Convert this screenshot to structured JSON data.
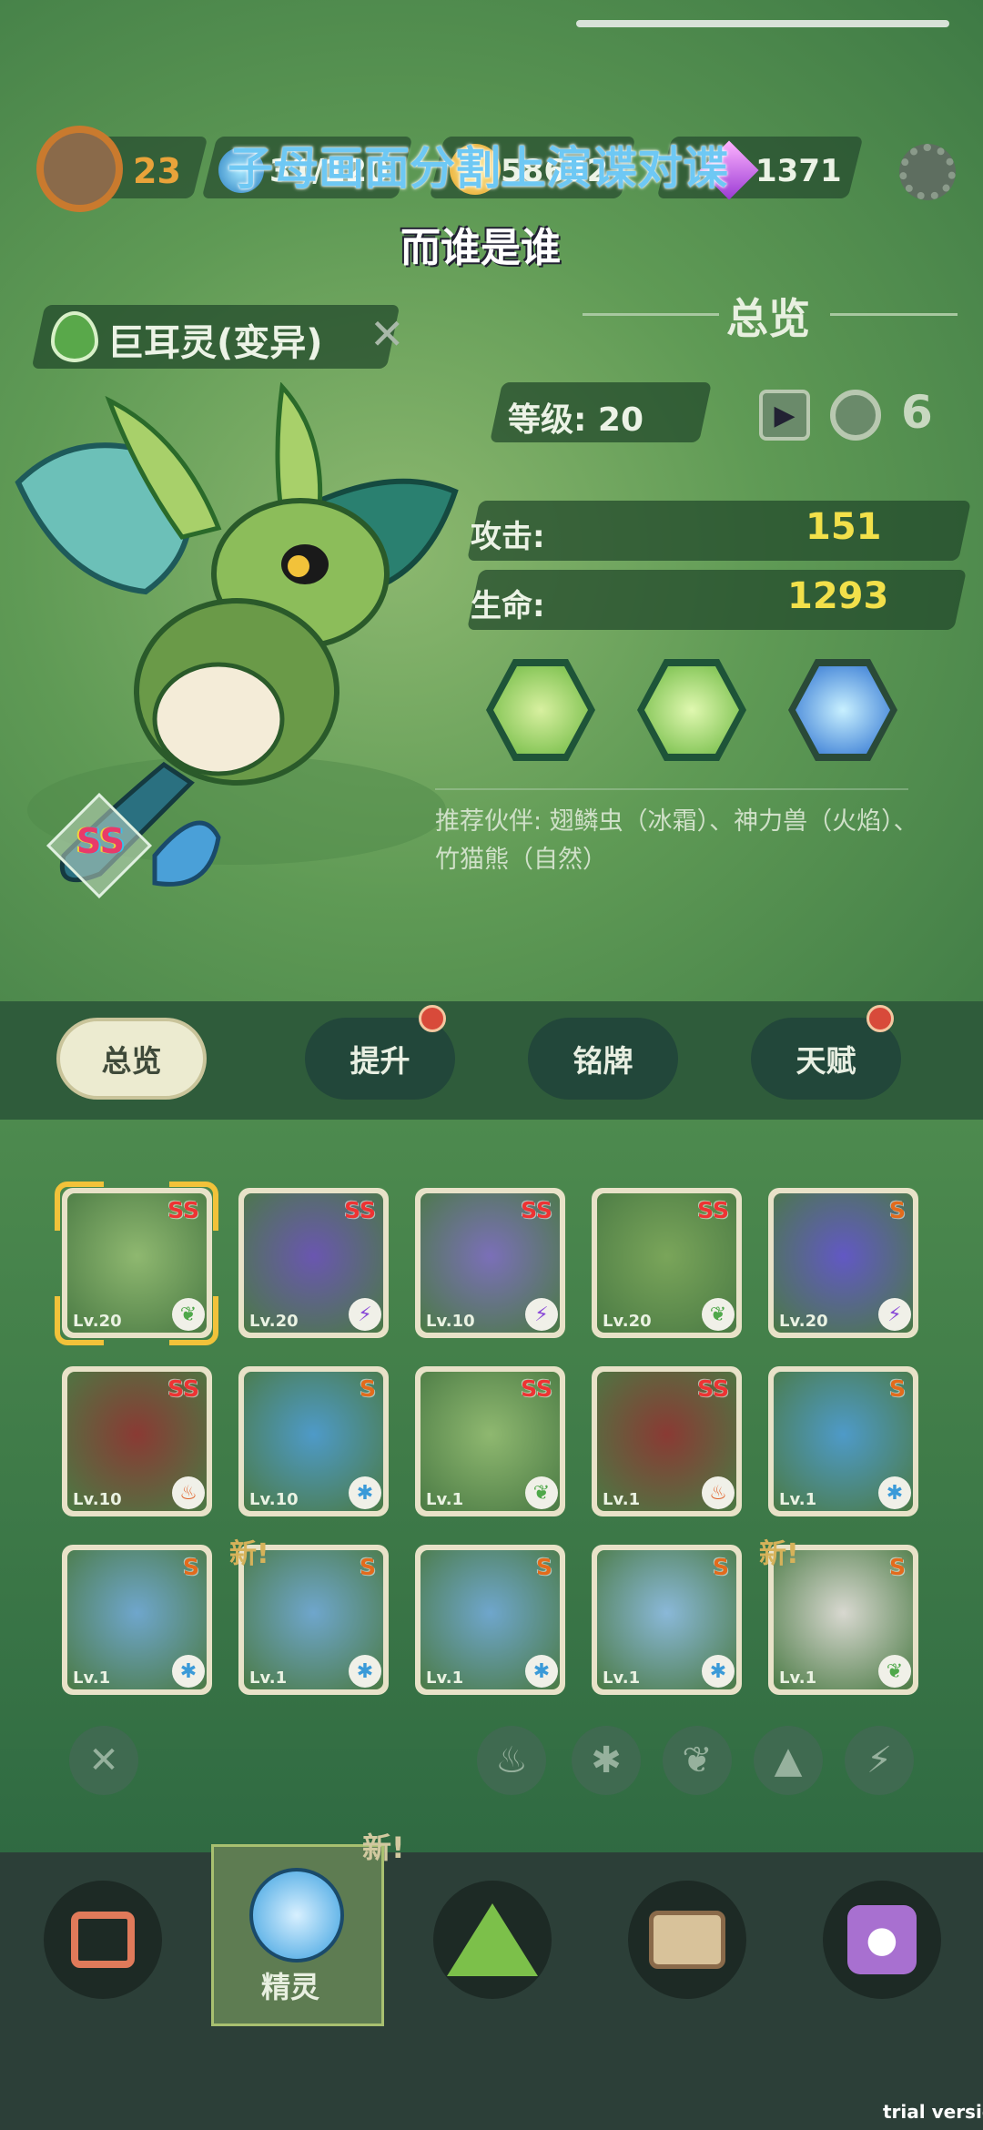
{
  "overlay": {
    "line1": "子母画面分割上演谍对谍",
    "line2": "而谁是谁"
  },
  "resources": {
    "level": "23",
    "energy": "31/120",
    "gold": "58632",
    "gems": "1371"
  },
  "monster": {
    "name": "巨耳灵(变异)",
    "rank": "SS"
  },
  "overview": {
    "title": "总览",
    "level_label": "等级: 20",
    "attack_label": "攻击:",
    "attack_value": "151",
    "hp_label": "生命:",
    "hp_value": "1293",
    "recommend": "推荐伙伴: 翅鳞虫（冰霜）、神力兽（火焰）、竹猫熊（自然）"
  },
  "tabs": [
    {
      "label": "总览",
      "active": true,
      "dot": false
    },
    {
      "label": "提升",
      "active": false,
      "dot": true
    },
    {
      "label": "铭牌",
      "active": false,
      "dot": false
    },
    {
      "label": "天赋",
      "active": false,
      "dot": true
    }
  ],
  "cards": [
    {
      "rank": "SS",
      "lv": "Lv.20",
      "color": "#8fb870",
      "elem": "leaf"
    },
    {
      "rank": "SS",
      "lv": "Lv.20",
      "color": "#6a56b0",
      "elem": "bolt"
    },
    {
      "rank": "SS",
      "lv": "Lv.10",
      "color": "#7b6fb8",
      "elem": "bolt"
    },
    {
      "rank": "SS",
      "lv": "Lv.20",
      "color": "#7aa55a",
      "elem": "leaf"
    },
    {
      "rank": "S",
      "lv": "Lv.20",
      "color": "#6258c4",
      "elem": "bolt"
    },
    {
      "rank": "SS",
      "lv": "Lv.10",
      "color": "#8a3a34",
      "elem": "fire"
    },
    {
      "rank": "S",
      "lv": "Lv.10",
      "color": "#4e9ac8",
      "elem": "ice"
    },
    {
      "rank": "SS",
      "lv": "Lv.1",
      "color": "#8fb870",
      "elem": "leaf"
    },
    {
      "rank": "SS",
      "lv": "Lv.1",
      "color": "#8a3a34",
      "elem": "fire"
    },
    {
      "rank": "S",
      "lv": "Lv.1",
      "color": "#4e9ac8",
      "elem": "ice"
    },
    {
      "rank": "S",
      "lv": "Lv.1",
      "color": "#6fa6cc",
      "elem": "ice"
    },
    {
      "rank": "S",
      "lv": "Lv.1",
      "color": "#6fa6cc",
      "elem": "ice",
      "new": "新!"
    },
    {
      "rank": "S",
      "lv": "Lv.1",
      "color": "#6fa6cc",
      "elem": "ice"
    },
    {
      "rank": "S",
      "lv": "Lv.1",
      "color": "#8ab8d8",
      "elem": "ice"
    },
    {
      "rank": "S",
      "lv": "Lv.1",
      "color": "#d8d8d0",
      "elem": "leaf",
      "new": "新!"
    }
  ],
  "nav": {
    "active_label": "精灵",
    "new_badge": "新!"
  },
  "watermark": "trial version",
  "colors": {
    "accent_yellow": "#f2e04a",
    "rank_ss": "#e33333",
    "rank_s": "#e36b1c"
  }
}
